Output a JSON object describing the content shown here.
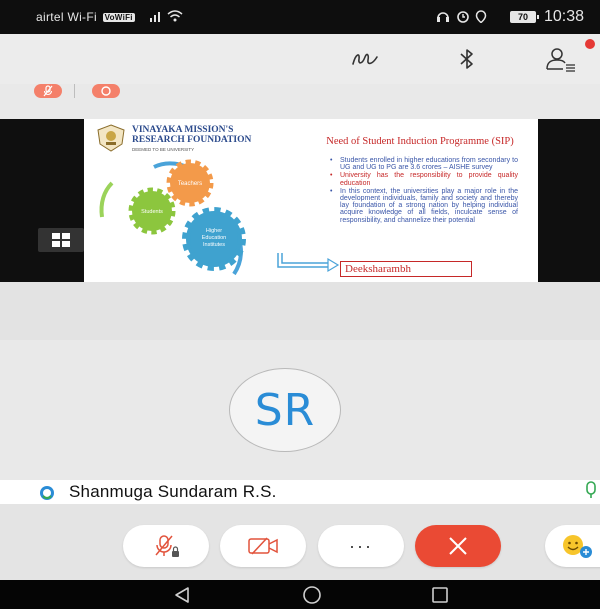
{
  "status_bar": {
    "carrier": "airtel Wi-Fi",
    "wifi_badge": "VoWiFi",
    "battery": "70",
    "time": "10:38"
  },
  "slide": {
    "org_line1": "VINAYAKA MISSION'S",
    "org_line2": "RESEARCH FOUNDATION",
    "org_sub": "DEEMED TO BE UNIVERSITY",
    "title": "Need of Student Induction Programme (SIP)",
    "bullets": [
      "Students enrolled in higher educations from secondary to UG and UG to PG are 3.6 crores – AISHE survey",
      "University has the responsibility to provide quality education",
      "In this context, the universities play a major role in the development individuals, family and society and thereby lay foundation of a strong nation by helping individual acquire knowledge of all fields, inculcate sense of responsibility, and channelize their potential"
    ],
    "gear_labels": [
      "Teachers",
      "Students",
      "Higher Education Institutes"
    ],
    "highlight": "Deeksharambh"
  },
  "participant": {
    "initials": "SR",
    "name": "Shanmuga Sundaram R.S."
  },
  "controls": {
    "more_label": "···"
  },
  "colors": {
    "end_call": "#ea4a34",
    "indicator": "#f4806a",
    "avatar_text": "#2a8cd6",
    "notification": "#e53935"
  },
  "icons": [
    "draw-icon",
    "bluetooth-icon",
    "participants-icon",
    "mic-muted-icon",
    "video-off-icon",
    "more-icon",
    "end-call-icon",
    "emoji-icon",
    "back-icon",
    "home-icon",
    "recents-icon",
    "layout-grid-icon"
  ]
}
